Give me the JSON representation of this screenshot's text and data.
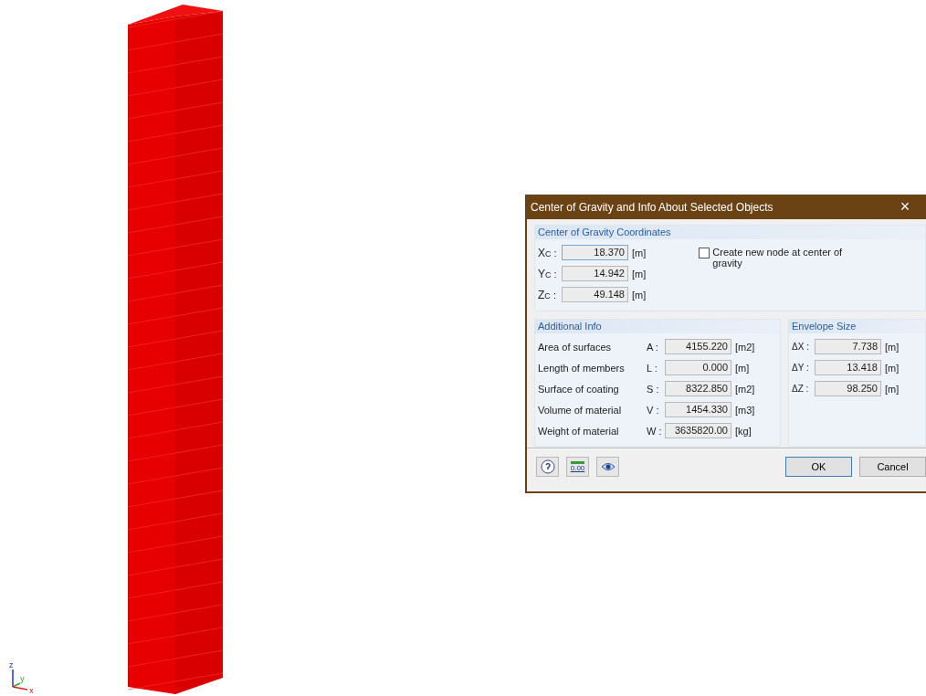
{
  "axes": [
    {
      "label": "z"
    },
    {
      "label": "y"
    },
    {
      "label": "x"
    }
  ],
  "dialog": {
    "title": "Center of Gravity and Info About Selected Objects",
    "close": "×",
    "coordinates": {
      "title": "Center of Gravity Coordinates",
      "rows": [
        {
          "symbol": "X",
          "sub": "C",
          "colon": ":",
          "value": "18.370",
          "unit": "[m]",
          "focused": true
        },
        {
          "symbol": "Y",
          "sub": "C",
          "colon": ":",
          "value": "14.942",
          "unit": "[m]",
          "focused": false
        },
        {
          "symbol": "Z",
          "sub": "C",
          "colon": ":",
          "value": "49.148",
          "unit": "[m]",
          "focused": false
        }
      ],
      "checkbox": {
        "label": "Create new node at center of gravity",
        "checked": false
      }
    },
    "additional_info": {
      "title": "Additional Info",
      "rows": [
        {
          "label": "Area of surfaces",
          "symbol": "A :",
          "value": "4155.220",
          "unit": "[m2]"
        },
        {
          "label": "Length of members",
          "symbol": "L :",
          "value": "0.000",
          "unit": "[m]"
        },
        {
          "label": "Surface of coating",
          "symbol": "S :",
          "value": "8322.850",
          "unit": "[m2]"
        },
        {
          "label": "Volume of material",
          "symbol": "V :",
          "value": "1454.330",
          "unit": "[m3]"
        },
        {
          "label": "Weight of material",
          "symbol": "W :",
          "value": "3635820.00",
          "unit": "[kg]"
        }
      ]
    },
    "envelope": {
      "title": "Envelope Size",
      "rows": [
        {
          "symbol": "ΔX :",
          "value": "7.738",
          "unit": "[m]"
        },
        {
          "symbol": "ΔY :",
          "value": "13.418",
          "unit": "[m]"
        },
        {
          "symbol": "ΔZ :",
          "value": "98.250",
          "unit": "[m]"
        }
      ]
    },
    "tool_buttons": [
      {
        "kind": "help"
      },
      {
        "kind": "decimals",
        "text": "0.00"
      },
      {
        "kind": "view"
      }
    ],
    "buttons": [
      {
        "label": "OK",
        "default": true
      },
      {
        "label": "Cancel",
        "default": false
      }
    ]
  }
}
